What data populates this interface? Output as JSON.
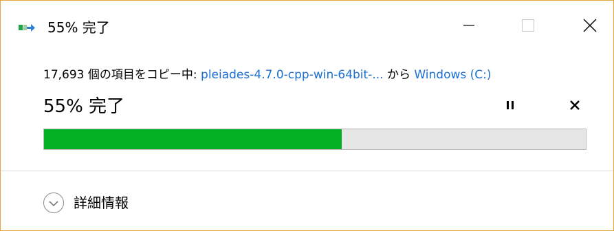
{
  "window": {
    "title": "55% 完了",
    "controls": {
      "minimize_icon": "minimize-icon",
      "maximize_icon": "maximize-icon",
      "close_icon": "close-icon"
    },
    "title_icon": "copy-progress-icon"
  },
  "copy": {
    "count_text": "17,693 個の項目をコピー中: ",
    "source": "pleiades-4.7.0-cpp-win-64bit-...",
    "from_text": " から ",
    "destination": "Windows (C:)",
    "percent_label": "55% 完了",
    "progress": 0.55
  },
  "actions": {
    "pause_icon": "pause-icon",
    "cancel_icon": "cancel-icon"
  },
  "details": {
    "label": "詳細情報",
    "icon": "chevron-down-icon"
  },
  "colors": {
    "accent_border": "#e8a33d",
    "progress_fill": "#06b025",
    "progress_track": "#e6e6e6",
    "link": "#1a6fd1"
  }
}
